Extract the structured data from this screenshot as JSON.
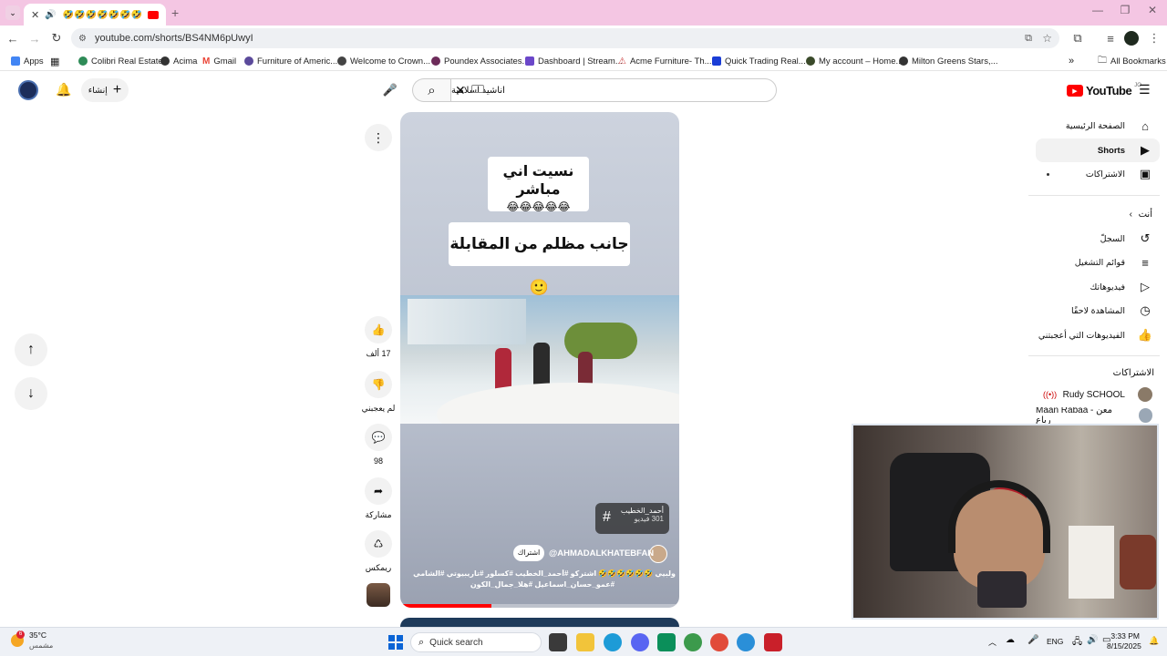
{
  "browser": {
    "tab_title": "🤣🤣🤣🤣🤣🤣🤣 ولبيي",
    "url": "youtube.com/shorts/BS4NM6pUwyI",
    "bookmarks": [
      {
        "label": "Apps",
        "color": "#4285f4"
      },
      {
        "label": "Colibri Real Estate",
        "color": "#2e8b57"
      },
      {
        "label": "Acima",
        "color": "#333333"
      },
      {
        "label": "Gmail",
        "color": "#ea4335"
      },
      {
        "label": "Furniture of Americ...",
        "color": "#5b4a9b"
      },
      {
        "label": "Welcome to Crown...",
        "color": "#444444"
      },
      {
        "label": "Poundex Associates...",
        "color": "#6d2b5a"
      },
      {
        "label": "Dashboard | Stream...",
        "color": "#6b47c9"
      },
      {
        "label": "Acme Furniture- Th...",
        "color": "#c44"
      },
      {
        "label": "Quick Trading Real...",
        "color": "#1a3dd6"
      },
      {
        "label": "My account – Home...",
        "color": "#3a4a2a"
      },
      {
        "label": "Milton Greens Stars,...",
        "color": "#333333"
      }
    ],
    "all_bookmarks": "All Bookmarks"
  },
  "youtube": {
    "logo_text": "YouTube",
    "logo_sup": "JO",
    "create_label": "إنشاء",
    "search_value": "اناشيد اسلامية",
    "short": {
      "caption_top": "نسيت اني مباشر",
      "caption_emojis": "😂😂😂😂😂",
      "caption_mid": "جانب مظلم من المقابلة 🙂",
      "hashtag_title": "أحمد_الخطيب",
      "hashtag_count": "301 فيديو",
      "channel": "@AHMADALKHATEBFAN",
      "subscribe": "اشتراك",
      "desc1": "ولبيي 🤣🤣🤣🤣🤣🤣 اشتركو #أحمد_الخطيب #كسلور #تاريبيوتي #الشامي",
      "desc2": "#عمو_حسان_اسماعيل #هلا_جمال_الكون"
    },
    "actions": {
      "likes": "17 ألف",
      "dislike": "لم يعجبني",
      "comments": "98",
      "share": "مشاركة",
      "remix": "ريمكس"
    },
    "sidebar": {
      "home": "الصفحة الرئيسية",
      "shorts": "Shorts",
      "subscriptions": "الاشتراكات",
      "you": "أنت",
      "history": "السجلّ",
      "playlists": "قوائم التشغيل",
      "your_videos": "فيديوهاتك",
      "watch_later": "المشاهدة لاحقًا",
      "liked": "الفيديوهات التي أعجبتني",
      "subs_heading": "الاشتراكات",
      "sub1": "Rudy SCHOOL",
      "sub2": "Maan Rabaa - معن رباع"
    }
  },
  "taskbar": {
    "weather_temp": "35°C",
    "weather_desc": "مشمس",
    "weather_badge": "6",
    "search_label": "Quick search",
    "lang": "ENG",
    "time": "3:33 PM",
    "date": "8/15/2025"
  }
}
